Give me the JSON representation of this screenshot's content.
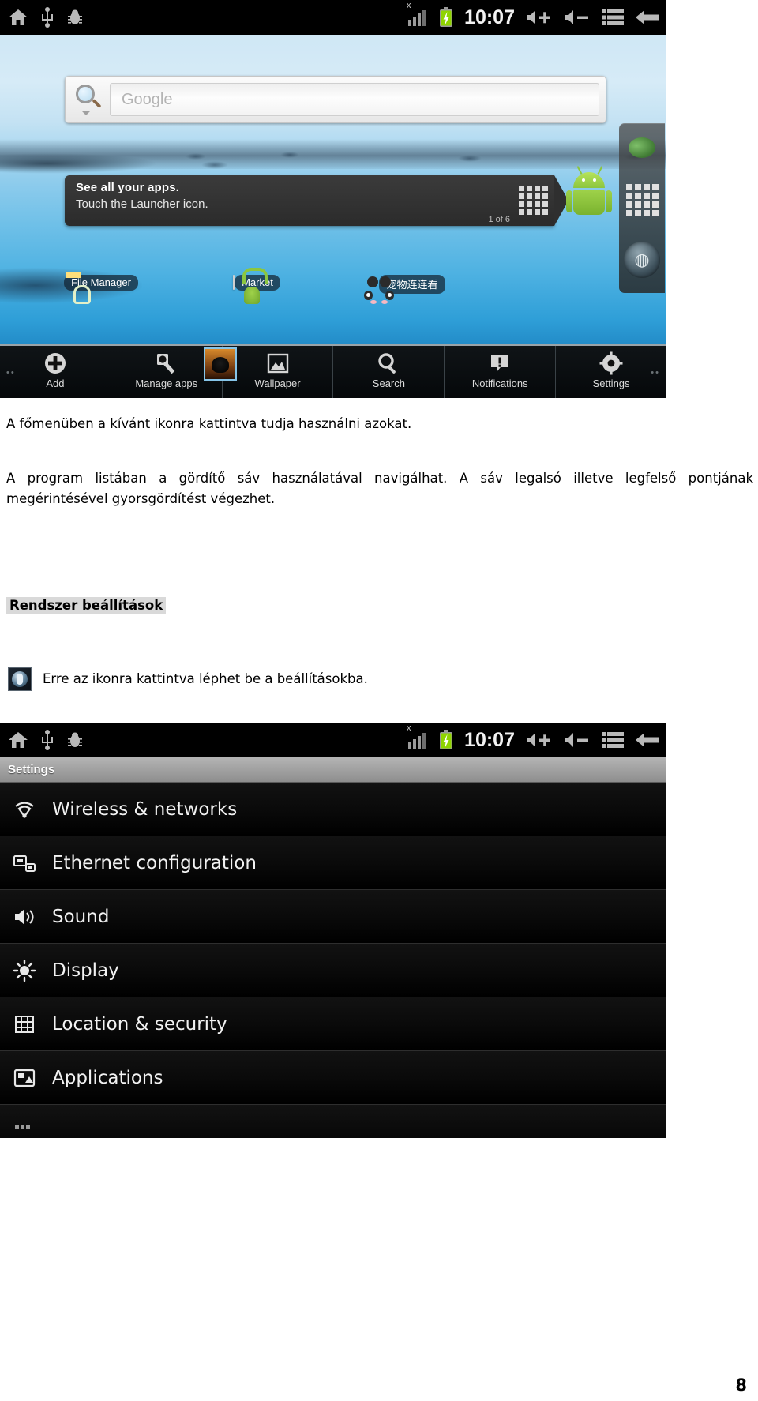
{
  "statusbar": {
    "icons_left": [
      "home-icon",
      "usb-icon",
      "bug-icon"
    ],
    "signal_icon": "signal-bars-icon",
    "signal_superscript": "x",
    "battery_icon": "battery-charging-icon",
    "clock": "10:07",
    "volume_up_icon": "volume-up-icon",
    "volume_down_icon": "volume-down-icon",
    "menu_icon": "menu-list-icon",
    "back_icon": "back-arrow-icon"
  },
  "home": {
    "search": {
      "placeholder": "Google",
      "icon": "search-magnifier-icon",
      "dropdown_icon": "chevron-down-icon"
    },
    "cling": {
      "title": "See all your apps.",
      "subtitle": "Touch the Launcher icon.",
      "page_indicator": "1 of 6",
      "grid_icon": "all-apps-grid-icon"
    },
    "shortcuts": [
      {
        "label": "File Manager",
        "icon": "file-manager-folder-icon"
      },
      {
        "label": "Market",
        "icon": "android-market-bag-icon"
      },
      {
        "label": "宠物连连看",
        "icon": "panda-game-icon"
      }
    ],
    "dock": [
      {
        "name": "browser-globe-icon"
      },
      {
        "name": "all-apps-grid-icon"
      },
      {
        "name": "clock-badge-icon"
      }
    ],
    "droid_icon": "android-robot-icon",
    "toolbar": [
      {
        "label": "Add",
        "icon": "plus-circle-icon"
      },
      {
        "label": "Manage apps",
        "icon": "wrench-icon"
      },
      {
        "label": "Wallpaper",
        "icon": "wallpaper-picture-icon"
      },
      {
        "label": "Search",
        "icon": "search-magnifier-icon"
      },
      {
        "label": "Notifications",
        "icon": "exclamation-badge-icon"
      },
      {
        "label": "Settings",
        "icon": "gear-icon"
      }
    ]
  },
  "document": {
    "paragraph1": "A főmenüben a kívánt ikonra kattintva tudja használni azokat.",
    "paragraph2": "A program listában a gördítő sáv használatával navigálhat. A sáv legalsó illetve legfelső pontjának megérintésével gyorsgördítést végezhet.",
    "heading": "Rendszer beállítások",
    "settings_note": "Erre az ikonra kattintva léphet be a beállításokba.",
    "settings_note_icon": "settings-gear-icon",
    "page_number": "8"
  },
  "settings_screen": {
    "title": "Settings",
    "rows": [
      {
        "label": "Wireless & networks",
        "icon": "wifi-icon"
      },
      {
        "label": "Ethernet configuration",
        "icon": "ethernet-icon"
      },
      {
        "label": "Sound",
        "icon": "speaker-icon"
      },
      {
        "label": "Display",
        "icon": "brightness-icon"
      },
      {
        "label": "Location & security",
        "icon": "lock-grid-icon"
      },
      {
        "label": "Applications",
        "icon": "applications-icon"
      },
      {
        "label": "",
        "icon": "accounts-icon"
      }
    ]
  },
  "colors": {
    "accent_green": "#8cc63f",
    "sky_top": "#cfe7f5",
    "sky_bottom": "#1878b4",
    "statusbar_bg": "#000000",
    "heading_highlight": "#d9d9d9"
  }
}
